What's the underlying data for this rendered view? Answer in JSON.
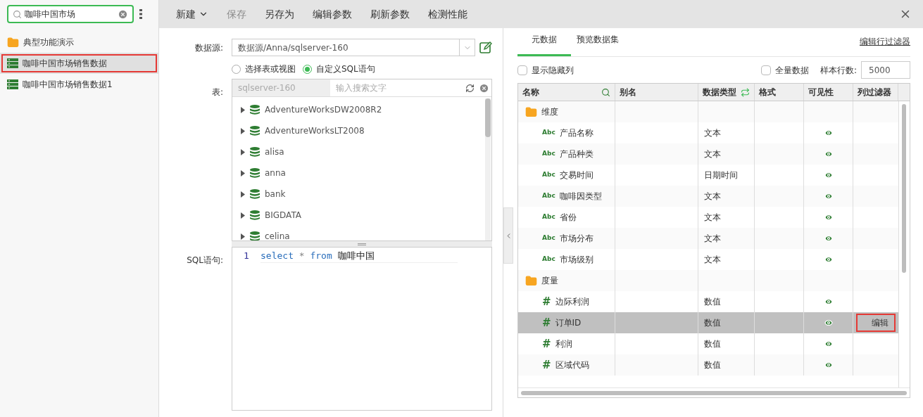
{
  "sidebar": {
    "search": {
      "value": "咖啡中国市场"
    },
    "items": [
      {
        "kind": "folder",
        "label": "典型功能演示",
        "selected": false,
        "highlighted": false
      },
      {
        "kind": "dataset",
        "label": "咖啡中国市场销售数据",
        "selected": true,
        "highlighted": true
      },
      {
        "kind": "dataset",
        "label": "咖啡中国市场销售数据1",
        "selected": false,
        "highlighted": false
      }
    ]
  },
  "toolbar": {
    "items": [
      {
        "label": "新建",
        "dropdown": true,
        "disabled": false
      },
      {
        "label": "保存",
        "dropdown": false,
        "disabled": true
      },
      {
        "label": "另存为",
        "dropdown": false,
        "disabled": false
      },
      {
        "label": "编辑参数",
        "dropdown": false,
        "disabled": false
      },
      {
        "label": "刷新参数",
        "dropdown": false,
        "disabled": false
      },
      {
        "label": "检测性能",
        "dropdown": false,
        "disabled": false
      }
    ]
  },
  "source": {
    "label": "数据源:",
    "value": "数据源/Anna/sqlserver-160",
    "modes": [
      {
        "label": "选择表或视图",
        "selected": false
      },
      {
        "label": "自定义SQL语句",
        "selected": true
      }
    ],
    "table_label": "表:",
    "server": "sqlserver-160",
    "search_placeholder": "输入搜索文字",
    "databases": [
      "AdventureWorksDW2008R2",
      "AdventureWorksLT2008",
      "alisa",
      "anna",
      "bank",
      "BIGDATA",
      "celina"
    ],
    "sql_label": "SQL语句:",
    "line_number": "1",
    "sql_tokens": [
      {
        "text": "select",
        "kind": "keyword"
      },
      {
        "text": "*",
        "kind": "operator"
      },
      {
        "text": "from",
        "kind": "keyword"
      },
      {
        "text": "咖啡中国",
        "kind": "plain"
      }
    ]
  },
  "meta": {
    "tabs": [
      {
        "label": "元数据",
        "selected": true
      },
      {
        "label": "预览数据集",
        "selected": false
      }
    ],
    "row_filter_link": "编辑行过滤器",
    "show_hidden": {
      "label": "显示隐藏列",
      "checked": false
    },
    "full_data": {
      "label": "全量数据",
      "checked": false
    },
    "sample_label": "样本行数:",
    "sample_value": "5000",
    "columns": [
      "名称",
      "别名",
      "数据类型",
      "格式",
      "可见性",
      "列过滤器"
    ],
    "rows": [
      {
        "kind": "folder",
        "name": "维度",
        "type": "",
        "selected": false
      },
      {
        "kind": "text",
        "icon": "Abc",
        "name": "产品名称",
        "type": "文本",
        "visible": true,
        "selected": false
      },
      {
        "kind": "text",
        "icon": "Abc",
        "name": "产品种类",
        "type": "文本",
        "visible": true,
        "selected": false
      },
      {
        "kind": "text",
        "icon": "Abc",
        "name": "交易时间",
        "type": "日期时间",
        "visible": true,
        "selected": false
      },
      {
        "kind": "text",
        "icon": "Abc",
        "name": "咖啡因类型",
        "type": "文本",
        "visible": true,
        "selected": false
      },
      {
        "kind": "text",
        "icon": "Abc",
        "name": "省份",
        "type": "文本",
        "visible": true,
        "selected": false
      },
      {
        "kind": "text",
        "icon": "Abc",
        "name": "市场分布",
        "type": "文本",
        "visible": true,
        "selected": false
      },
      {
        "kind": "text",
        "icon": "Abc",
        "name": "市场级别",
        "type": "文本",
        "visible": true,
        "selected": false
      },
      {
        "kind": "folder",
        "name": "度量",
        "type": "",
        "selected": false
      },
      {
        "kind": "number",
        "icon": "#",
        "name": "边际利润",
        "type": "数值",
        "visible": true,
        "selected": false
      },
      {
        "kind": "number",
        "icon": "#",
        "name": "订单ID",
        "type": "数值",
        "visible": true,
        "selected": true,
        "filter_button": "编辑"
      },
      {
        "kind": "number",
        "icon": "#",
        "name": "利润",
        "type": "数值",
        "visible": true,
        "selected": false
      },
      {
        "kind": "number",
        "icon": "#",
        "name": "区域代码",
        "type": "数值",
        "visible": true,
        "selected": false
      }
    ]
  }
}
